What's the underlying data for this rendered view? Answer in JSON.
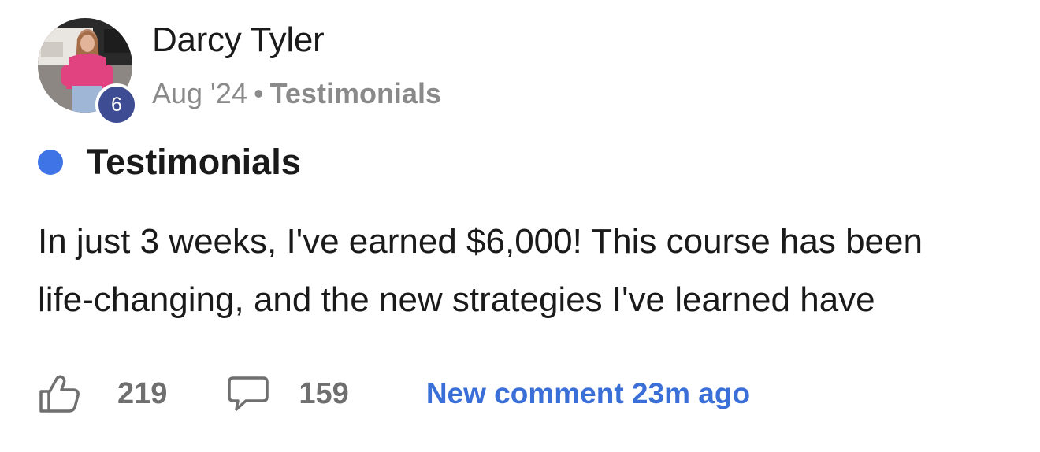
{
  "post": {
    "author": {
      "name": "Darcy Tyler",
      "level": "6"
    },
    "meta": {
      "date": "Aug '24",
      "separator": "•",
      "category": "Testimonials"
    },
    "category": {
      "label": "Testimonials",
      "color": "#3f74e6"
    },
    "body": {
      "lines": [
        "In just 3 weeks, I've earned $6,000! This course has been",
        "life-changing, and the new strategies I've learned have"
      ]
    },
    "footer": {
      "likes": "219",
      "comments": "159",
      "new_comment": "New comment 23m ago",
      "like_icon": "thumbs-up-icon",
      "comment_icon": "comment-bubble-icon"
    }
  }
}
